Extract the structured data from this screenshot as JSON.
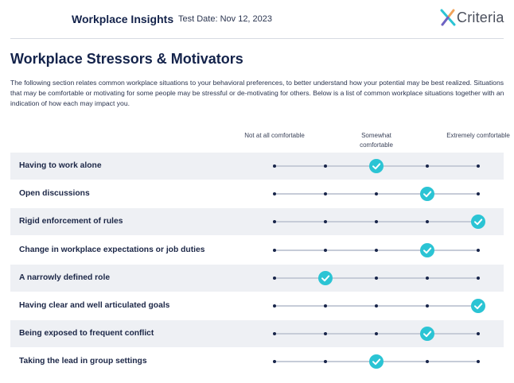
{
  "header": {
    "brand": "Workplace Insights",
    "test_date": "Test Date: Nov 12, 2023",
    "logo_text": "Criteria"
  },
  "section": {
    "title": "Workplace Stressors & Motivators",
    "intro": "The following section relates common workplace situations to your behavioral preferences, to better understand how your potential may be best realized. Situations that may be comfortable or motivating for some people may be stressful or de-motivating for others. Below is a list of common workplace situations together with an indication of how each may impact you."
  },
  "scale": {
    "points": 5,
    "labels": [
      {
        "text": "Not at all comfortable",
        "position": 1
      },
      {
        "text": "Somewhat comfortable",
        "position": 3
      },
      {
        "text": "Extremely comfortable",
        "position": 5
      }
    ]
  },
  "rows": [
    {
      "label": "Having to work alone",
      "selected": 3
    },
    {
      "label": "Open discussions",
      "selected": 4
    },
    {
      "label": "Rigid enforcement of rules",
      "selected": 5
    },
    {
      "label": "Change in workplace expectations or job duties",
      "selected": 4
    },
    {
      "label": "A narrowly defined role",
      "selected": 2
    },
    {
      "label": "Having clear and well articulated goals",
      "selected": 5
    },
    {
      "label": "Being exposed to frequent conflict",
      "selected": 4
    },
    {
      "label": "Taking the lead in group settings",
      "selected": 3
    }
  ],
  "colors": {
    "accent": "#2bc4d4",
    "navy": "#14234b",
    "row_shade": "#eef0f4",
    "track": "#c6ccd8"
  }
}
